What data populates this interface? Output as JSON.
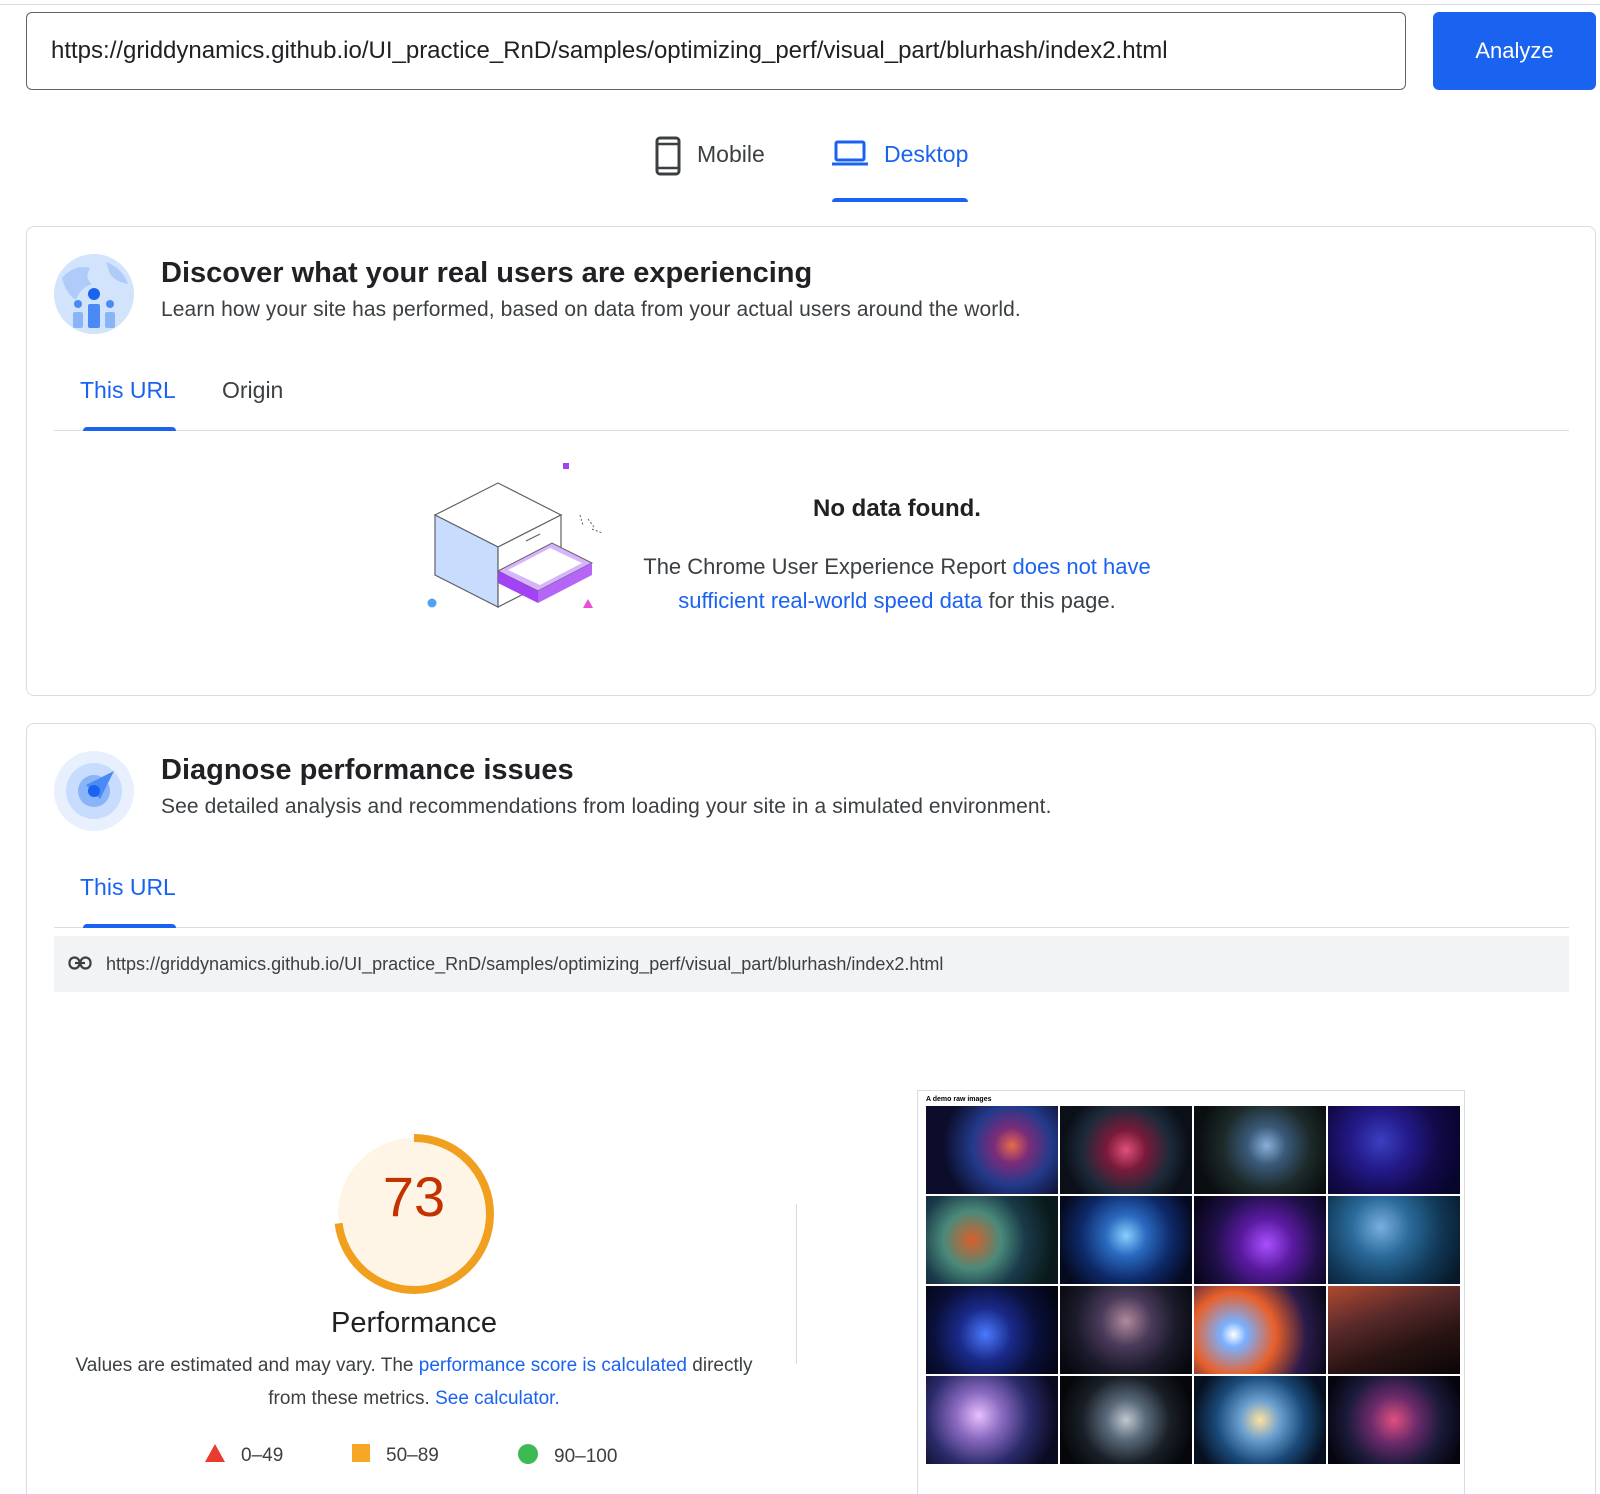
{
  "search": {
    "url_value": "https://griddynamics.github.io/UI_practice_RnD/samples/optimizing_perf/visual_part/blurhash/index2.html",
    "analyze_label": "Analyze"
  },
  "device_tabs": [
    {
      "label": "Mobile",
      "icon": "phone-icon",
      "active": false
    },
    {
      "label": "Desktop",
      "icon": "laptop-icon",
      "active": true
    }
  ],
  "field_data": {
    "title": "Discover what your real users are experiencing",
    "subtitle": "Learn how your site has performed, based on data from your actual users around the world.",
    "tabs": [
      "This URL",
      "Origin"
    ],
    "active_tab": "This URL",
    "empty_title": "No data found.",
    "empty_text_prefix": "The Chrome User Experience Report ",
    "empty_link": "does not have sufficient real-world speed data",
    "empty_text_suffix": " for this page."
  },
  "lab_data": {
    "title": "Diagnose performance issues",
    "subtitle": "See detailed analysis and recommendations from loading your site in a simulated environment.",
    "tabs": [
      "This URL"
    ],
    "tested_url": "https://griddynamics.github.io/UI_practice_RnD/samples/optimizing_perf/visual_part/blurhash/index2.html",
    "score": "73",
    "score_value": 73,
    "score_color": "#c33300",
    "gauge_color": "#f0a01e",
    "category": "Performance",
    "note_prefix": "Values are estimated and may vary. The ",
    "note_link1": "performance score is calculated",
    "note_mid": " directly from these metrics. ",
    "note_link2": "See calculator.",
    "legend": [
      {
        "range": "0–49",
        "shape": "triangle",
        "color": "#eb3b2f"
      },
      {
        "range": "50–89",
        "shape": "square",
        "color": "#f5a623"
      },
      {
        "range": "90–100",
        "shape": "circle",
        "color": "#3cba54"
      }
    ],
    "screenshot_caption": "A demo raw images"
  },
  "colors": {
    "accent": "#1a63f0",
    "border": "#dadce0"
  }
}
